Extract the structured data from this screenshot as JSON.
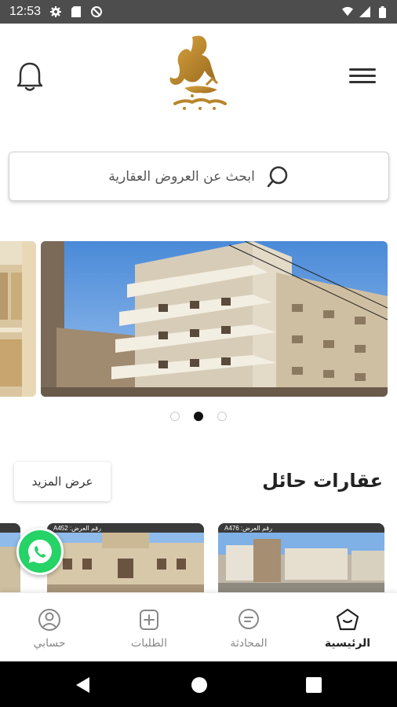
{
  "status_bar": {
    "time": "12:53"
  },
  "search": {
    "placeholder": "ابحث عن العروض العقارية"
  },
  "carousel": {
    "dot_count": 3,
    "active_dot": 1
  },
  "section": {
    "title": "عقارات حائل",
    "more_label": "عرض المزيد"
  },
  "cards": [
    {
      "label": "رقم العرض: A476"
    },
    {
      "label": "رقم العرض: A452"
    }
  ],
  "bottom_nav": {
    "home": "الرئيسية",
    "chat": "المحادثة",
    "requests": "الطلبات",
    "account": "حسابي"
  },
  "colors": {
    "brand_gold": "#b8862b",
    "status_bar": "#4d4d4d",
    "whatsapp": "#25d366"
  },
  "icons": [
    "settings-icon",
    "sd-card-icon",
    "no-data-icon",
    "wifi-icon",
    "signal-icon",
    "battery-icon",
    "bell-icon",
    "menu-icon",
    "search-icon",
    "whatsapp-icon",
    "home-icon",
    "chat-icon",
    "add-request-icon",
    "account-icon"
  ]
}
